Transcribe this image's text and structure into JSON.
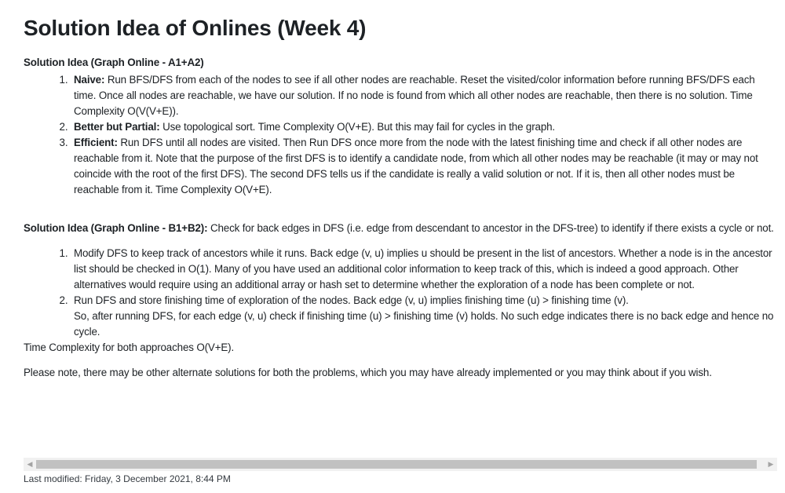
{
  "page": {
    "title": "Solution Idea of Onlines (Week 4)"
  },
  "section1": {
    "heading": "Solution Idea (Graph Online - A1+A2)",
    "items": [
      {
        "label": "Naive:",
        "text": " Run BFS/DFS from each of the nodes to see if all other nodes are reachable. Reset the visited/color information before running BFS/DFS each time. Once all nodes are reachable, we have our solution. If no node is found from which all other nodes are reachable, then there is no solution. Time Complexity O(V(V+E))."
      },
      {
        "label": "Better but Partial:",
        "text": " Use topological sort. Time Complexity O(V+E). But this may fail for cycles in the graph."
      },
      {
        "label": "Efficient:",
        "text": " Run DFS until all nodes are visited. Then Run DFS once more from the node with the latest finishing time and check if all other nodes are reachable from it. Note that the purpose of the first DFS is to identify a candidate node, from which all other nodes may be reachable (it may or may not coincide with the root of the first DFS). The second DFS tells us if the candidate is really a valid solution or not. If it is, then all other nodes must be reachable from it. Time Complexity O(V+E)."
      }
    ]
  },
  "section2": {
    "heading": "Solution Idea (Graph Online - B1+B2):",
    "intro": " Check for back edges in DFS (i.e. edge from descendant to ancestor in the DFS-tree) to identify if there exists a cycle or not.",
    "items": [
      {
        "text": "Modify DFS to keep track of ancestors while it runs. Back edge (v, u) implies u should be present in the list of ancestors. Whether a node is in the ancestor list should be checked in O(1). Many of you have used an additional color information to keep track of this, which is indeed a good approach. Other alternatives would require using an additional array or hash set to determine whether the exploration of a node has been complete or not."
      },
      {
        "text": "Run DFS and store finishing time of exploration of the nodes. Back edge (v, u) implies finishing time (u) > finishing time (v).",
        "text2": "So, after running DFS, for each edge (v, u) check if finishing time (u) > finishing time (v) holds. No such edge indicates there is no back edge and hence no cycle."
      }
    ],
    "complexity": "Time Complexity for both approaches O(V+E)."
  },
  "note": "Please note, there may be other alternate solutions for both the problems, which you may have already implemented or you may think about if you wish.",
  "scrollbar": {
    "left_arrow": "◀",
    "right_arrow": "▶"
  },
  "footer": {
    "last_modified": "Last modified: Friday, 3 December 2021, 8:44 PM"
  }
}
